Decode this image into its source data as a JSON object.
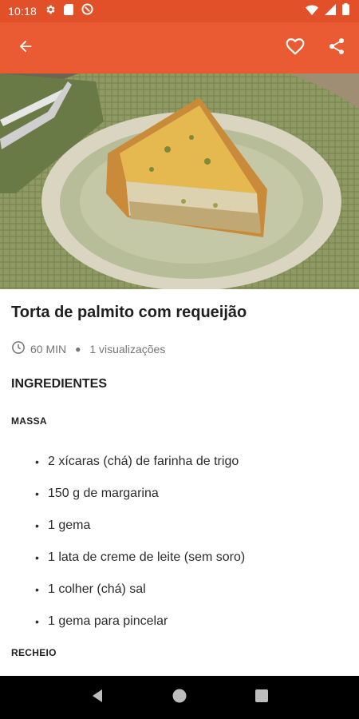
{
  "status_bar": {
    "time": "10:18",
    "left_icons": [
      "gear-icon",
      "sim-card-icon",
      "no-disturb-icon"
    ],
    "right_icons": [
      "wifi-icon",
      "signal-icon",
      "battery-icon"
    ]
  },
  "app_bar": {
    "icons": [
      "back-arrow-icon",
      "heart-outline-icon",
      "share-icon"
    ],
    "color": "#ea5b33"
  },
  "recipe": {
    "title": "Torta de palmito com requeijão",
    "time": "60 MIN",
    "views": "1 visualizações",
    "ingredients_heading": "INGREDIENTES",
    "sections": [
      {
        "name": "MASSA",
        "items": [
          "2 xícaras (chá) de farinha de trigo",
          "150 g de margarina",
          "1 gema",
          "1 lata de creme de leite (sem soro)",
          "1 colher (chá) sal",
          "1 gema para pincelar"
        ]
      },
      {
        "name": "RECHEIO",
        "items": []
      }
    ]
  },
  "nav_bar": {
    "icons": [
      "back-triangle-icon",
      "home-circle-icon",
      "recents-square-icon"
    ]
  }
}
